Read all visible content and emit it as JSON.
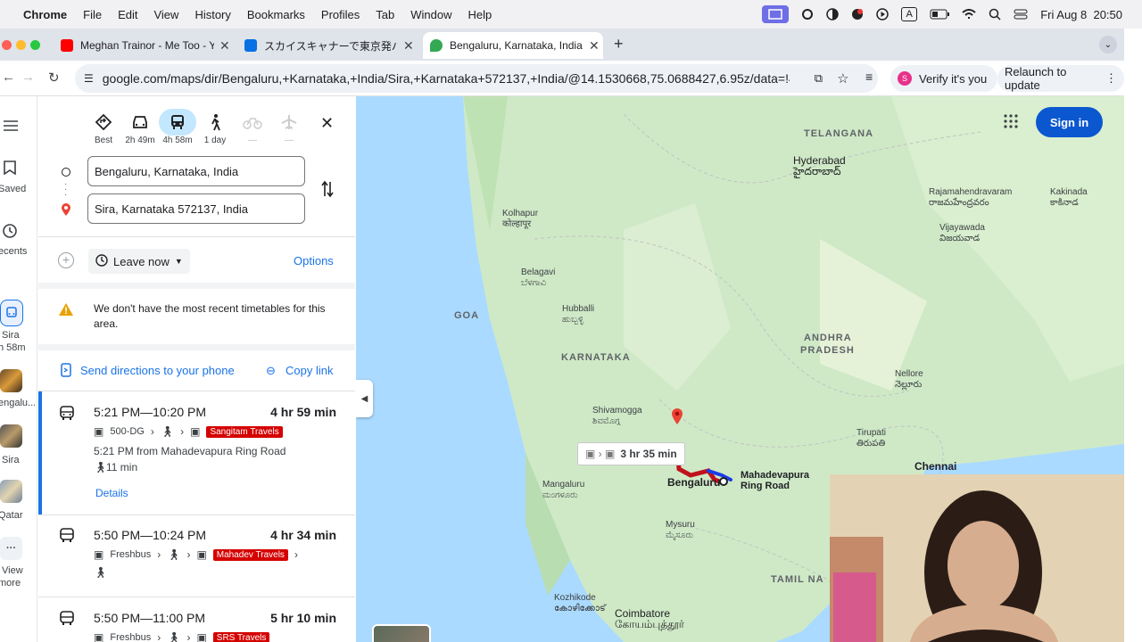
{
  "menubar": {
    "app": "Chrome",
    "items": [
      "File",
      "Edit",
      "View",
      "History",
      "Bookmarks",
      "Profiles",
      "Tab",
      "Window",
      "Help"
    ],
    "clock": "Fri Aug 8  20:50"
  },
  "tabs": [
    {
      "title": "Meghan Trainor - Me Too - Yo",
      "favicon_color": "#ff0000"
    },
    {
      "title": "スカイスキャナーで東京発バンコク",
      "favicon_color": "#0770e3"
    },
    {
      "title": "Bengaluru, Karnataka, India to",
      "favicon_color": "#34a853"
    }
  ],
  "toolbar": {
    "url": "google.com/maps/dir/Bengaluru,+Karnataka,+India/Sira,+Karnataka+572137,+India/@14.1530668,75.0688427,6.95z/data=!4m14!4...",
    "verify_label": "Verify it's you",
    "relaunch_label": "Relaunch to update"
  },
  "left_rail": {
    "saved": "Saved",
    "recents": "ecents",
    "items": [
      "Sira",
      "h 58m",
      "engalu...",
      "Sira",
      "Qatar"
    ],
    "view_more_1": "View",
    "view_more_2": "more"
  },
  "travel_modes": [
    {
      "name": "Best",
      "time": "Best"
    },
    {
      "name": "Driving",
      "time": "2h 49m"
    },
    {
      "name": "Transit",
      "time": "4h 58m"
    },
    {
      "name": "Walking",
      "time": "1 day"
    },
    {
      "name": "Cycling",
      "time": "—"
    },
    {
      "name": "Flights",
      "time": "—"
    }
  ],
  "directions": {
    "origin": "Bengaluru, Karnataka, India",
    "destination": "Sira, Karnataka 572137, India",
    "leave_now": "Leave now",
    "options": "Options",
    "warning": "We don't have the most recent timetables for this area.",
    "send_to_phone": "Send directions to your phone",
    "copy_link": "Copy link"
  },
  "trips": [
    {
      "time": "5:21 PM—10:20 PM",
      "duration": "4 hr 59 min",
      "bus": "500-DG",
      "operator": "Sangitam Travels",
      "from": "5:21 PM from Mahadevapura Ring Road",
      "walk": "11 min",
      "details": "Details"
    },
    {
      "time": "5:50 PM—10:24 PM",
      "duration": "4 hr 34 min",
      "bus": "Freshbus",
      "operator": "Mahadev Travels"
    },
    {
      "time": "5:50 PM—11:00 PM",
      "duration": "5 hr 10 min",
      "bus": "Freshbus",
      "operator": "SRS Travels"
    }
  ],
  "map": {
    "sign_in": "Sign in",
    "route_label": "3 hr 35 min",
    "places": [
      {
        "name": "Hyderabad",
        "sub": "హైదరాబాద్"
      },
      {
        "name": "Rajamahendravaram",
        "sub": "రాజమహేంద్రవరం"
      },
      {
        "name": "Kakinada",
        "sub": "కాకినాడ"
      },
      {
        "name": "Kolhapur",
        "sub": "कोल्हापूर"
      },
      {
        "name": "Vijayawada",
        "sub": "విజయవాడ"
      },
      {
        "name": "Belagavi",
        "sub": "ಬೆಳಗಾವಿ"
      },
      {
        "name": "Hubballi",
        "sub": "ಹುಬ್ಬಳ್ಳಿ"
      },
      {
        "name": "Nellore",
        "sub": "నెల్లూరు"
      },
      {
        "name": "Shivamogga",
        "sub": "ಶಿವಮೊಗ್ಗ"
      },
      {
        "name": "Tirupati",
        "sub": "తిరుపతి"
      },
      {
        "name": "Mangaluru",
        "sub": "ಮಂಗಳೂರು"
      },
      {
        "name": "Mysuru",
        "sub": "ಮೈಸೂರು"
      },
      {
        "name": "Kozhikode",
        "sub": "കോഴിക്കോട്"
      },
      {
        "name": "Coimbatore",
        "sub": "கோயம்புத்தூர்"
      }
    ],
    "regions": [
      "TELANGANA",
      "GOA",
      "KARNATAKA",
      "ANDHRA",
      "PRADESH",
      "TAMIL NA"
    ],
    "bengaluru": "Bengaluru",
    "mahadevapura_1": "Mahadevapura",
    "mahadevapura_2": "Ring Road",
    "chennai": "Chennai"
  }
}
